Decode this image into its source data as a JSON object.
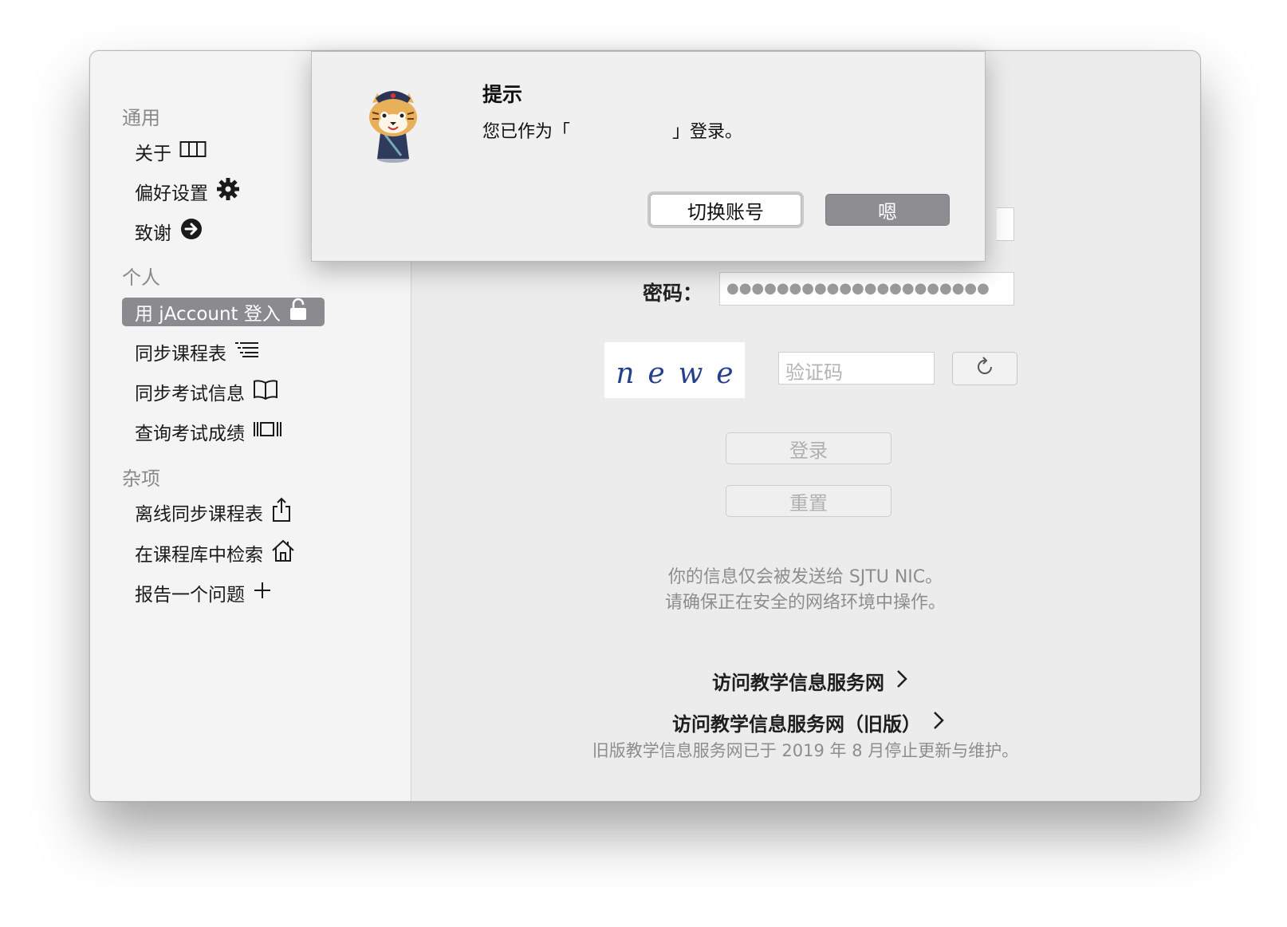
{
  "sidebar": {
    "sections": [
      {
        "title": "通用"
      },
      {
        "title": "个人"
      },
      {
        "title": "杂项"
      }
    ],
    "items": [
      {
        "label": "关于",
        "icon": "columns-icon"
      },
      {
        "label": "偏好设置",
        "icon": "gear-icon"
      },
      {
        "label": "致谢",
        "icon": "arrow-right-circle-icon"
      },
      {
        "label": "用 jAccount 登入",
        "icon": "lock-open-icon",
        "selected": true
      },
      {
        "label": "同步课程表",
        "icon": "list-icon"
      },
      {
        "label": "同步考试信息",
        "icon": "book-icon"
      },
      {
        "label": "查询考试成绩",
        "icon": "score-bars-icon"
      },
      {
        "label": "离线同步课程表",
        "icon": "share-icon"
      },
      {
        "label": "在课程库中检索",
        "icon": "house-icon"
      },
      {
        "label": "报告一个问题",
        "icon": "plus-icon"
      }
    ]
  },
  "login": {
    "password_label": "密码：",
    "password_value": "●●●●●●●●●●●●●●●●●●●●●",
    "captcha_chars": [
      "n",
      "e",
      "w",
      "e"
    ],
    "captcha_placeholder": "验证码",
    "login_button": "登录",
    "reset_button": "重置",
    "info_line1": "你的信息仅会被发送给 SJTU NIC。",
    "info_line2": "请确保正在安全的网络环境中操作。",
    "link1": "访问教学信息服务网",
    "link2": "访问教学信息服务网（旧版）",
    "footnote": "旧版教学信息服务网已于 2019 年 8 月停止更新与维护。"
  },
  "alert": {
    "title": "提示",
    "message_prefix": "您已作为「",
    "message_suffix": "」登录。",
    "secondary_button": "切换账号",
    "primary_button": "嗯"
  },
  "colors": {
    "selected_bg": "#8b8b8f",
    "window_bg": "#ececec",
    "captcha_text": "#27408b"
  }
}
